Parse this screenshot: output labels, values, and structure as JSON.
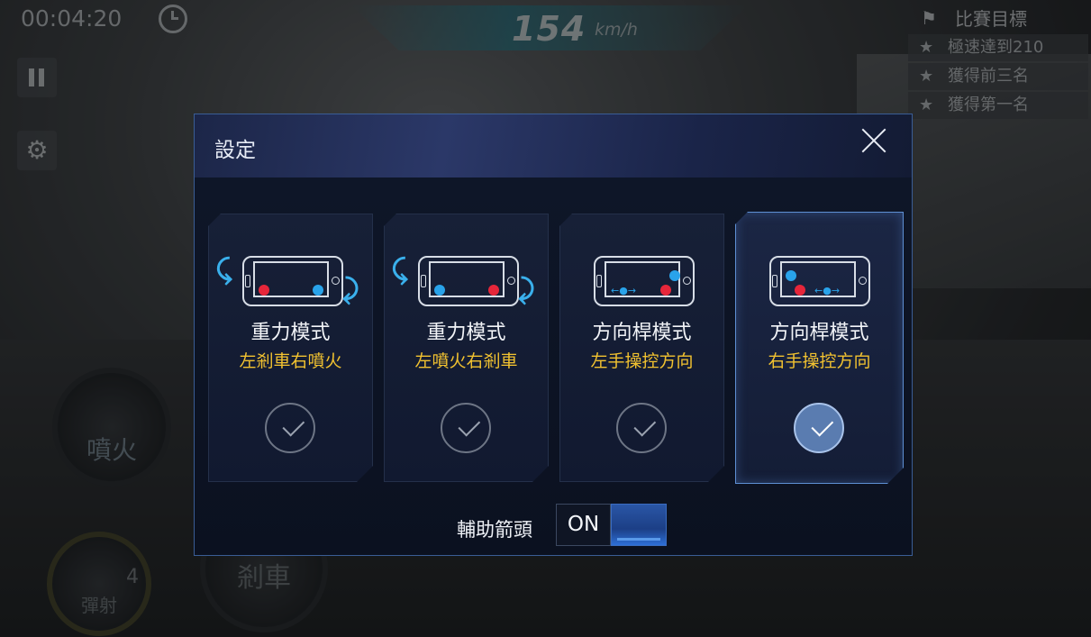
{
  "hud": {
    "timer": "00:04:20",
    "speed": "154",
    "speed_unit": "km/h",
    "goals_title": "比賽目標",
    "goals": [
      "極速達到210",
      "獲得前三名",
      "獲得第一名"
    ],
    "fire_label": "噴火",
    "brake_label": "剎車",
    "boost_label": "彈射",
    "boost_count": "4"
  },
  "dialog": {
    "title": "設定",
    "modes": [
      {
        "name": "重力模式",
        "desc": "左剎車右噴火",
        "selected": false
      },
      {
        "name": "重力模式",
        "desc": "左噴火右剎車",
        "selected": false
      },
      {
        "name": "方向桿模式",
        "desc": "左手操控方向",
        "selected": false
      },
      {
        "name": "方向桿模式",
        "desc": "右手操控方向",
        "selected": true
      }
    ],
    "assist_label": "輔助箭頭",
    "assist_value": "ON"
  },
  "colors": {
    "accent_yellow": "#f2c230",
    "dot_red": "#e6263a",
    "dot_blue": "#29a3ea",
    "toggle_blue": "#2a56a6"
  },
  "icons": [
    "clock-icon",
    "pause-icon",
    "gear-icon",
    "flag-icon",
    "star-icon",
    "close-icon",
    "rotate-left-icon",
    "rotate-right-icon",
    "check-icon"
  ]
}
